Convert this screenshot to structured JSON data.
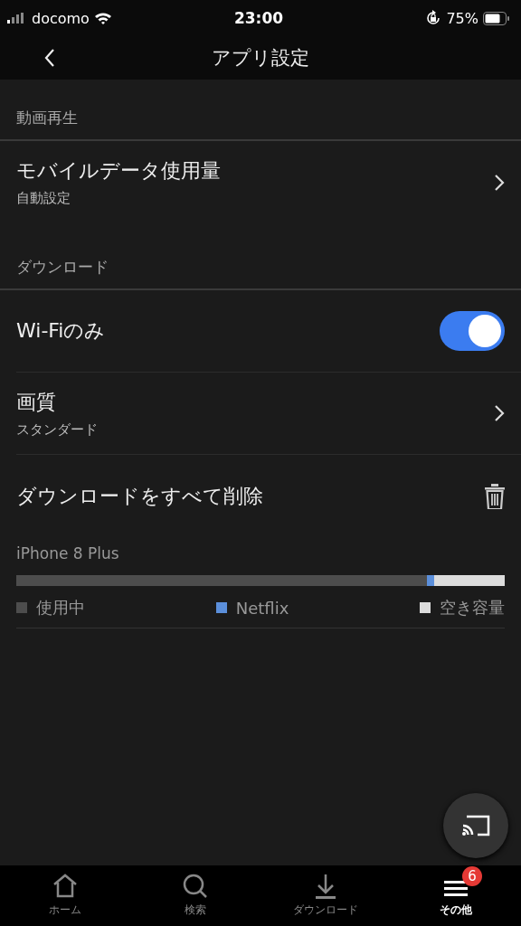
{
  "status_bar": {
    "carrier": "docomo",
    "time": "23:00",
    "battery": "75%"
  },
  "header": {
    "title": "アプリ設定"
  },
  "sections": [
    {
      "title": "動画再生",
      "items": [
        {
          "kind": "link",
          "label": "モバイルデータ使用量",
          "detail": "自動設定"
        }
      ]
    },
    {
      "title": "ダウンロード",
      "items": [
        {
          "kind": "toggle",
          "label": "Wi-Fiのみ",
          "on": true
        },
        {
          "kind": "link",
          "label": "画質",
          "detail": "スタンダード"
        },
        {
          "kind": "action",
          "label": "ダウンロードをすべて削除"
        }
      ]
    }
  ],
  "storage": {
    "device": "iPhone 8 Plus",
    "segments": [
      {
        "label": "使用中",
        "color": "#4d4d4d",
        "level": 0.84
      },
      {
        "label": "Netflix",
        "color": "#5b8fdb"
      },
      {
        "label": "空き容量",
        "color": "#dcdcdc",
        "level": 0.145
      }
    ]
  },
  "tabs": [
    {
      "kind": "home",
      "label": "ホーム",
      "selected": false
    },
    {
      "kind": "search",
      "label": "検索",
      "selected": false
    },
    {
      "kind": "download",
      "label": "ダウンロード",
      "selected": false
    },
    {
      "kind": "more",
      "label": "その他",
      "selected": true,
      "badge": "6"
    }
  ]
}
